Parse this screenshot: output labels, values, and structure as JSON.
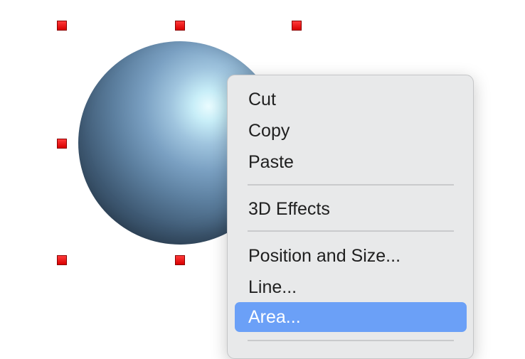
{
  "document": {
    "selected_object": "sphere",
    "handle_color": "#e00000"
  },
  "context_menu": {
    "items": [
      {
        "label": "Cut"
      },
      {
        "label": "Copy"
      },
      {
        "label": "Paste"
      },
      {
        "label": "3D Effects"
      },
      {
        "label": "Position and Size..."
      },
      {
        "label": "Line..."
      },
      {
        "label": "Area..."
      }
    ],
    "highlighted": "Area...",
    "highlight_color": "#6ba0f7",
    "background_color": "#e8e9ea"
  }
}
